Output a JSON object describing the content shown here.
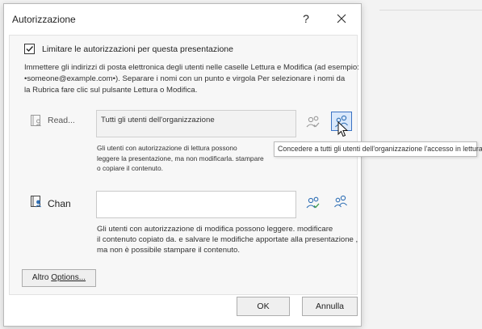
{
  "dialog": {
    "title": "Autorizzazione",
    "help_label": "?",
    "restrict_checkbox": {
      "label": "Limitare le autorizzazioni per questa presentazione",
      "checked": true
    },
    "instructions": [
      "Immettere gli indirizzi di posta elettronica degli utenti nelle caselle Lettura e Modifica (ad esempio:",
      "•someone@example.com•). Separare i nomi con un punto e virgola Per selezionare i nomi da",
      "la Rubrica fare clic sul pulsante Lettura o Modifica."
    ],
    "read": {
      "label": "Read...",
      "value": "Tutti gli utenti dell'organizzazione",
      "description": [
        "Gli utenti con autorizzazione di lettura possono",
        "leggere la presentazione, ma non modificarla. stampare",
        "o copiare il contenuto."
      ]
    },
    "change": {
      "label": "Chan",
      "value": "",
      "description": [
        "Gli utenti con autorizzazione di modifica possono leggere. modificare",
        "il contenuto copiato da. e salvare le modifiche apportate alla presentazione ,",
        "ma non è possibile stampare il contenuto."
      ]
    },
    "tooltip": "Concedere a tutti gli utenti dell'organizzazione l'accesso in lettura",
    "options_button": {
      "prefix": "Altro",
      "label": "Options..."
    },
    "ok_label": "OK",
    "cancel_label": "Annulla"
  },
  "colors": {
    "accent": "#3a72c4",
    "icon_green": "#3c9a4a",
    "icon_blue": "#2f6fb5",
    "icon_gray": "#9a9a9a"
  },
  "icons": {
    "address_book": "address-book-icon",
    "check_names": "check-names-icon",
    "everyone": "everyone-icon",
    "close": "close-icon",
    "cursor": "mouse-pointer-icon"
  }
}
